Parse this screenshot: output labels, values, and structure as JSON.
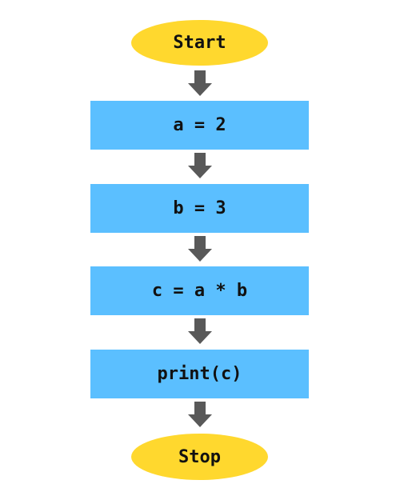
{
  "colors": {
    "terminal": "#FFD82E",
    "process": "#5BBFFF",
    "arrow": "#595959",
    "text": "#111111"
  },
  "flowchart": {
    "start": {
      "type": "terminal",
      "label": "Start"
    },
    "steps": [
      {
        "type": "process",
        "label": "a = 2"
      },
      {
        "type": "process",
        "label": "b = 3"
      },
      {
        "type": "process",
        "label": "c = a * b"
      },
      {
        "type": "process",
        "label": "print(c)"
      }
    ],
    "stop": {
      "type": "terminal",
      "label": "Stop"
    }
  }
}
